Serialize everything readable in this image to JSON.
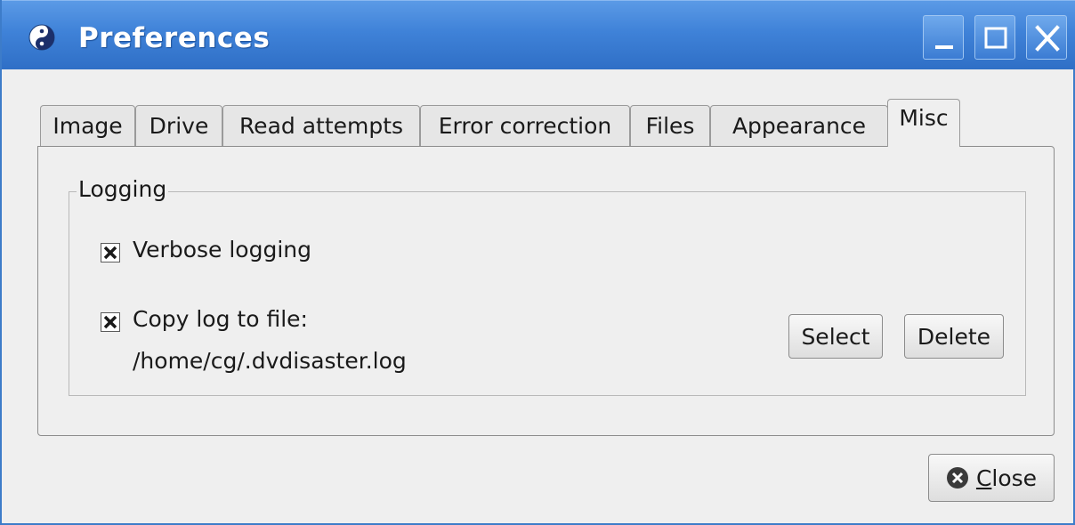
{
  "window": {
    "title": "Preferences",
    "controls": {
      "minimize": "minimize-icon",
      "maximize": "maximize-icon",
      "close": "close-x-icon"
    },
    "title_color": "#ffffff",
    "titlebar_color": "#3f82d8"
  },
  "tabs": [
    {
      "label": "Image",
      "active": false
    },
    {
      "label": "Drive",
      "active": false
    },
    {
      "label": "Read attempts",
      "active": false
    },
    {
      "label": "Error correction",
      "active": false
    },
    {
      "label": "Files",
      "active": false
    },
    {
      "label": "Appearance",
      "active": false
    },
    {
      "label": "Misc",
      "active": true
    }
  ],
  "misc": {
    "logging": {
      "group_label": "Logging",
      "verbose": {
        "label": "Verbose logging",
        "checked": true
      },
      "copy_log": {
        "label": "Copy log to file:",
        "checked": true,
        "path": "/home/cg/.dvdisaster.log",
        "select_label": "Select",
        "delete_label": "Delete"
      }
    }
  },
  "footer": {
    "close_label": "lose",
    "close_mnemonic": "C"
  }
}
